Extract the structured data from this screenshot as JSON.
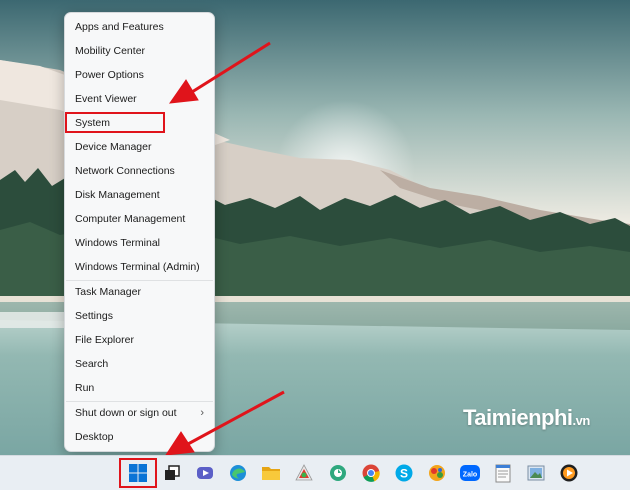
{
  "context_menu": {
    "items": [
      {
        "label": "Apps and Features"
      },
      {
        "label": "Mobility Center"
      },
      {
        "label": "Power Options"
      },
      {
        "label": "Event Viewer"
      },
      {
        "label": "System",
        "highlighted": true
      },
      {
        "label": "Device Manager"
      },
      {
        "label": "Network Connections"
      },
      {
        "label": "Disk Management"
      },
      {
        "label": "Computer Management"
      },
      {
        "label": "Windows Terminal"
      },
      {
        "label": "Windows Terminal (Admin)"
      },
      {
        "label": "Task Manager"
      },
      {
        "label": "Settings"
      },
      {
        "label": "File Explorer"
      },
      {
        "label": "Search"
      },
      {
        "label": "Run"
      },
      {
        "label": "Shut down or sign out",
        "has_submenu": true
      },
      {
        "label": "Desktop"
      }
    ],
    "submenu_chevron": "›"
  },
  "annotation_color": "#e0141b",
  "taskbar": {
    "icons": [
      "start-icon",
      "task-view-icon",
      "teams-chat-icon",
      "edge-icon",
      "file-explorer-icon",
      "app-icon",
      "app-icon",
      "chrome-icon",
      "skype-icon",
      "app-icon",
      "zalo-icon",
      "notepad-icon",
      "app-icon",
      "media-player-icon"
    ],
    "zalo_label": "Zalo"
  },
  "watermark": {
    "brand": "Taimienphi",
    "suffix": ".vn"
  }
}
